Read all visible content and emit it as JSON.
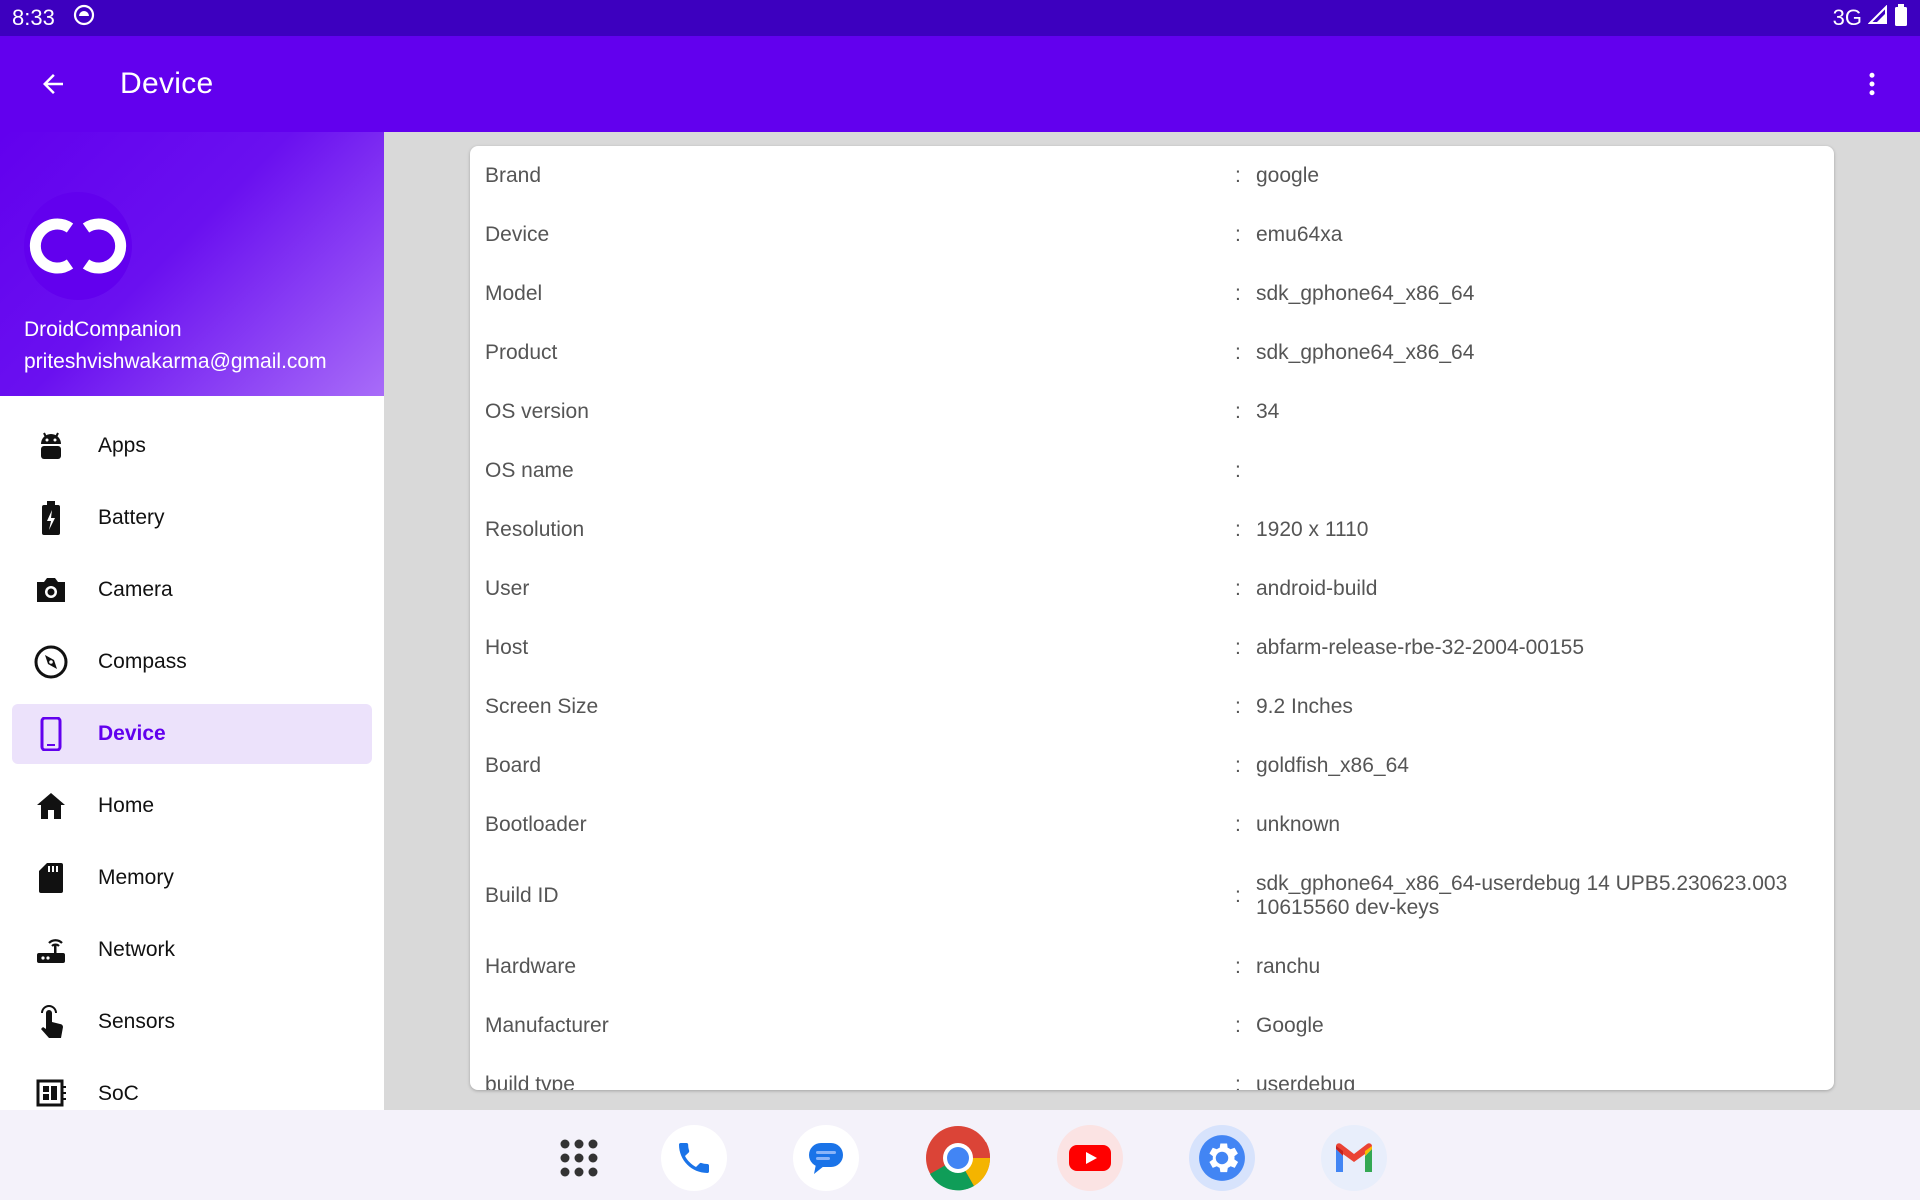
{
  "status_bar": {
    "time": "8:33",
    "network": "3G",
    "icons": [
      "android-notification-icon",
      "signal-icon",
      "battery-icon"
    ]
  },
  "app_bar": {
    "title": "Device",
    "back_icon": "arrow-back-icon",
    "menu_icon": "more-vert-icon"
  },
  "drawer": {
    "app_name": "DroidCompanion",
    "email": "priteshvishwakarma@gmail.com",
    "items": [
      {
        "label": "Apps",
        "icon": "android-icon"
      },
      {
        "label": "Battery",
        "icon": "battery-charging-icon"
      },
      {
        "label": "Camera",
        "icon": "camera-icon"
      },
      {
        "label": "Compass",
        "icon": "compass-icon"
      },
      {
        "label": "Device",
        "icon": "phone-device-icon",
        "active": true
      },
      {
        "label": "Home",
        "icon": "home-icon"
      },
      {
        "label": "Memory",
        "icon": "sd-card-icon"
      },
      {
        "label": "Network",
        "icon": "router-icon"
      },
      {
        "label": "Sensors",
        "icon": "touch-icon"
      },
      {
        "label": "SoC",
        "icon": "chip-icon"
      }
    ]
  },
  "device_info": [
    {
      "key": "Brand",
      "value": "google"
    },
    {
      "key": "Device",
      "value": "emu64xa"
    },
    {
      "key": "Model",
      "value": "sdk_gphone64_x86_64"
    },
    {
      "key": "Product",
      "value": "sdk_gphone64_x86_64"
    },
    {
      "key": "OS version",
      "value": "34"
    },
    {
      "key": "OS name",
      "value": ""
    },
    {
      "key": "Resolution",
      "value": "1920 x 1110"
    },
    {
      "key": "User",
      "value": "android-build"
    },
    {
      "key": "Host",
      "value": "abfarm-release-rbe-32-2004-00155"
    },
    {
      "key": "Screen Size",
      "value": "9.2 Inches"
    },
    {
      "key": "Board",
      "value": "goldfish_x86_64"
    },
    {
      "key": "Bootloader",
      "value": "unknown"
    },
    {
      "key": "Build ID",
      "value": "sdk_gphone64_x86_64-userdebug 14 UPB5.230623.003 10615560 dev-keys"
    },
    {
      "key": "Hardware",
      "value": "ranchu"
    },
    {
      "key": "Manufacturer",
      "value": "Google"
    },
    {
      "key": "build type",
      "value": "userdebug"
    }
  ],
  "separator": ":",
  "taskbar": [
    "app-drawer-icon",
    "phone-icon",
    "messages-icon",
    "chrome-icon",
    "youtube-icon",
    "settings-icon",
    "gmail-icon"
  ],
  "colors": {
    "primary": "#6200ee",
    "status_bar": "#3d00bf",
    "active_bg": "#ece2fb"
  }
}
